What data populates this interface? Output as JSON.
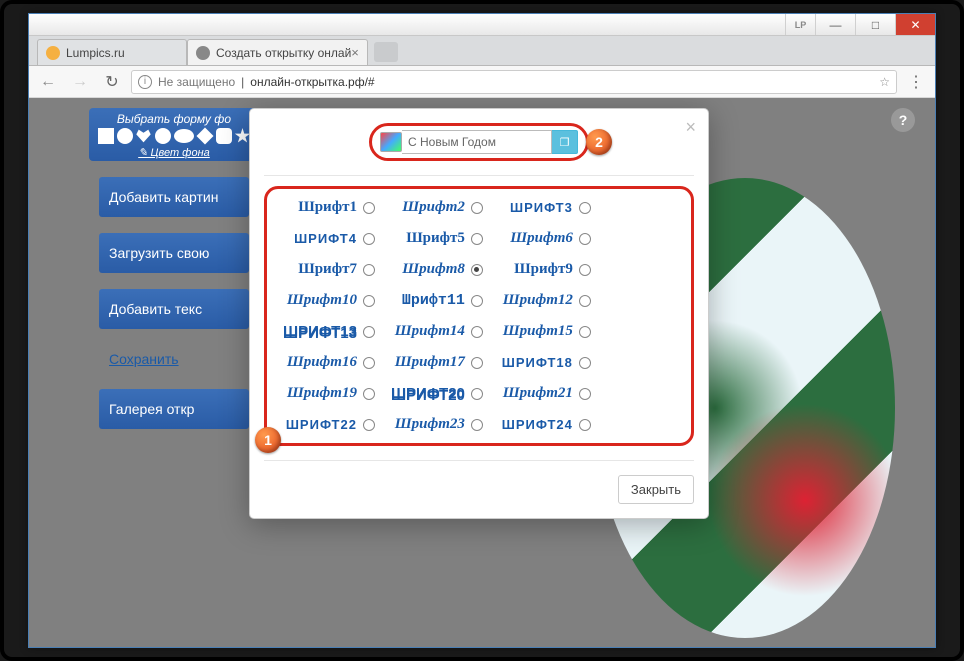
{
  "window": {
    "lp": "LP",
    "min": "—",
    "max": "□",
    "close": "✕"
  },
  "tabs": [
    {
      "title": "Lumpics.ru"
    },
    {
      "title": "Создать открытку онлай",
      "close": "×"
    }
  ],
  "addr": {
    "insecure": "Не защищено",
    "url": "онлайн-открытка.рф/#",
    "info": "i",
    "star": "☆",
    "menu": "⋮",
    "back": "←",
    "fwd": "→",
    "reload": "↻"
  },
  "side": {
    "shape_title": "Выбрать форму фо",
    "shape_sub": "✎ Цвет фона",
    "btn_add_image": "Добавить картин",
    "btn_upload": "Загрузить свою",
    "btn_add_text": "Добавить текс",
    "link_save": "Сохранить",
    "btn_gallery": "Галерея откр"
  },
  "help": "?",
  "modal": {
    "close_x": "×",
    "text_value": "С Новым Годом",
    "apply_icon": "❐",
    "close_label": "Закрыть",
    "badge1": "1",
    "badge2": "2",
    "fonts": [
      {
        "label": "Шрифт1",
        "v": "v1",
        "sel": false
      },
      {
        "label": "Шрифт2",
        "v": "v2",
        "sel": false
      },
      {
        "label": "ШРИФТ3",
        "v": "v3",
        "sel": false
      },
      {
        "label": "ШРИФТ4",
        "v": "v3",
        "sel": false
      },
      {
        "label": "Шрифт5",
        "v": "v1",
        "sel": false
      },
      {
        "label": "Шрифт6",
        "v": "v5",
        "sel": false
      },
      {
        "label": "Шрифт7",
        "v": "v1",
        "sel": false
      },
      {
        "label": "Шрифт8",
        "v": "v2",
        "sel": true
      },
      {
        "label": "Шрифт9",
        "v": "v1",
        "sel": false
      },
      {
        "label": "Шрифт10",
        "v": "v2",
        "sel": false
      },
      {
        "label": "Шрифт11",
        "v": "v4",
        "sel": false
      },
      {
        "label": "Шрифт12",
        "v": "v5",
        "sel": false
      },
      {
        "label": "ШРИФТ13",
        "v": "v6",
        "sel": false
      },
      {
        "label": "Шрифт14",
        "v": "v2",
        "sel": false
      },
      {
        "label": "Шрифт15",
        "v": "v2",
        "sel": false
      },
      {
        "label": "Шрифт16",
        "v": "v2",
        "sel": false
      },
      {
        "label": "Шрифт17",
        "v": "v5",
        "sel": false
      },
      {
        "label": "ШРИФТ18",
        "v": "v3",
        "sel": false
      },
      {
        "label": "Шрифт19",
        "v": "v2",
        "sel": false
      },
      {
        "label": "ШРИФТ20",
        "v": "v6",
        "sel": false
      },
      {
        "label": "Шрифт21",
        "v": "v5",
        "sel": false
      },
      {
        "label": "ШРИФТ22",
        "v": "v3",
        "sel": false
      },
      {
        "label": "Шрифт23",
        "v": "v2",
        "sel": false
      },
      {
        "label": "ШРИФТ24",
        "v": "v3",
        "sel": false
      }
    ]
  }
}
